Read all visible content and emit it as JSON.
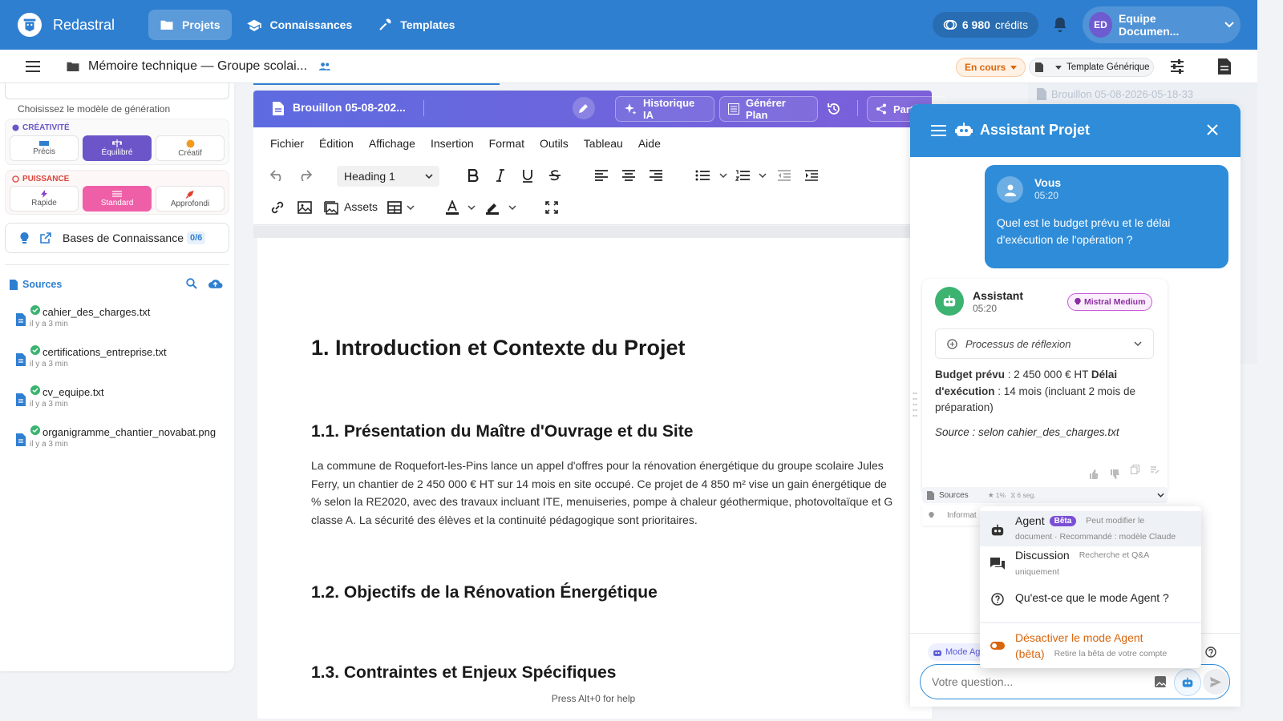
{
  "topbar": {
    "brand": "Redastral",
    "nav": [
      "Projets",
      "Connaissances",
      "Templates"
    ],
    "credits_value": "6 980",
    "credits_label": "crédits",
    "team_initials": "ED",
    "team_name": "Equipe Documen..."
  },
  "docbar": {
    "title": "Mémoire technique — Groupe scolai...",
    "status": "En cours",
    "template": "Template Générique"
  },
  "left": {
    "model_hint": "Choisissez le modèle de génération",
    "creativity_label": "CRÉATIVITÉ",
    "creativity_options": [
      "Précis",
      "Équilibré",
      "Créatif"
    ],
    "power_label": "PUISSANCE",
    "power_options": [
      "Rapide",
      "Standard",
      "Approfondi"
    ],
    "kb_label": "Bases de Connaissance",
    "kb_count": "0/6",
    "sources_title": "Sources",
    "sources": [
      {
        "name": "cahier_des_charges.txt",
        "time": "il y a 3 min"
      },
      {
        "name": "certifications_entreprise.txt",
        "time": "il y a 3 min"
      },
      {
        "name": "cv_equipe.txt",
        "time": "il y a 3 min"
      },
      {
        "name": "organigramme_chantier_novabat.png",
        "time": "il y a 3 min"
      }
    ]
  },
  "editor": {
    "draft_title": "Brouillon 05-08-202...",
    "history_btn": "Historique IA",
    "plan_btn": "Générer Plan",
    "share_btn": "Parta",
    "menus": [
      "Fichier",
      "Édition",
      "Affichage",
      "Insertion",
      "Format",
      "Outils",
      "Tableau",
      "Aide"
    ],
    "block_format": "Heading 1",
    "assets_label": "Assets",
    "h1": "1. Introduction et Contexte du Projet",
    "h2_1": "1.1. Présentation du Maître d'Ouvrage et du Site",
    "para_lines": [
      "La commune de Roquefort-les-Pins lance un appel d'offres pour la rénovation énergétique du groupe scolaire Jules",
      "Ferry, un chantier de 2 450 000 € HT sur 14 mois en site occupé. Ce projet de 4 850 m² vise un gain énergétique de",
      "% selon la RE2020, avec des travaux incluant ITE, menuiseries, pompe à chaleur géothermique, photovoltaïque et G",
      "classe A. La sécurité des élèves et la continuité pédagogique sont prioritaires."
    ],
    "h2_2": "1.2. Objectifs de la Rénovation Énergétique",
    "h2_3": "1.3. Contraintes et Enjeux Spécifiques",
    "help": "Press Alt+0 for help"
  },
  "right_bg": {
    "draft": "Brouillon 05-08-2026-05-18-33"
  },
  "assistant": {
    "title": "Assistant Projet",
    "user_name": "Vous",
    "user_time": "05:20",
    "user_msg": "Quel est le budget prévu et le délai d'exécution de l'opération ?",
    "bot_name": "Assistant",
    "bot_time": "05:20",
    "model_badge": "Mistral Medium",
    "thinking": "Processus de réflexion",
    "ans_budget_label": "Budget prévu",
    "ans_budget_value": " : 2 450 000 € HT ",
    "ans_delay_label": "Délai d'exécution",
    "ans_delay_value": " : 14 mois (incluant 2 mois de préparation)",
    "ans_source": "Source : selon cahier_des_charges.txt",
    "sources_label": "Sources",
    "sources_meta1": "1%",
    "sources_meta2": "6 seg.",
    "info_label": "Informat",
    "mode_chip": "Mode Agent",
    "input_placeholder": "Votre question..."
  },
  "dropdown": {
    "agent_title": "Agent",
    "agent_badge": "Bêta",
    "agent_desc1": "Peut modifier le",
    "agent_desc2": "document · Recommandé : modèle Claude",
    "disc_title": "Discussion",
    "disc_desc1": "Recherche et Q&A",
    "disc_desc2": "uniquement",
    "what_title": "Qu'est-ce que le mode Agent ?",
    "deact_title1": "Désactiver le mode Agent",
    "deact_title2": "(bêta)",
    "deact_desc": "Retire la bêta de votre compte"
  }
}
